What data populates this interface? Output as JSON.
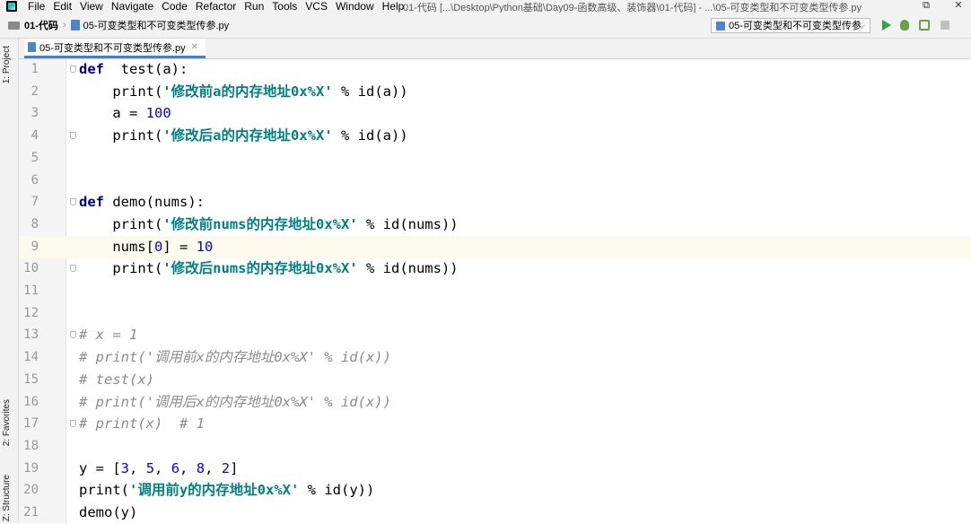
{
  "menubar": {
    "items": [
      "File",
      "Edit",
      "View",
      "Navigate",
      "Code",
      "Refactor",
      "Run",
      "Tools",
      "VCS",
      "Window",
      "Help"
    ],
    "title": "01-代码 [...\\Desktop\\Python基础\\Day09-函数高级、装饰器\\01-代码] - ...\\05-可变类型和不可变类型传参.py",
    "controls": [
      "⧉",
      "✕"
    ]
  },
  "navbar": {
    "project": "01-代码",
    "file": "05-可变类型和不可变类型传参.py",
    "run_config": "05-可变类型和不可变类型传参",
    "dropdown_arrow": "⌵"
  },
  "toolstrip": {
    "project": "1: Project",
    "favorites": "2: Favorites",
    "structure": "Z: Structure"
  },
  "editor_tab": {
    "label": "05-可变类型和不可变类型传参.py",
    "close": "✕"
  },
  "current_line": 9,
  "code_lines": [
    {
      "n": "1",
      "tokens": [
        [
          "kw",
          "def"
        ],
        [
          "",
          "  test(a):"
        ]
      ]
    },
    {
      "n": "2",
      "tokens": [
        [
          "",
          "    print("
        ],
        [
          "str",
          "'修改前a的内存地址0x%X'"
        ],
        [
          "",
          " % id(a))"
        ]
      ]
    },
    {
      "n": "3",
      "tokens": [
        [
          "",
          "    a = "
        ],
        [
          "num",
          "100"
        ]
      ]
    },
    {
      "n": "4",
      "tokens": [
        [
          "",
          "    print("
        ],
        [
          "str",
          "'修改后a的内存地址0x%X'"
        ],
        [
          "",
          " % id(a))"
        ]
      ]
    },
    {
      "n": "5",
      "tokens": []
    },
    {
      "n": "6",
      "tokens": []
    },
    {
      "n": "7",
      "tokens": [
        [
          "kw",
          "def"
        ],
        [
          "",
          " demo(nums):"
        ]
      ]
    },
    {
      "n": "8",
      "tokens": [
        [
          "",
          "    print("
        ],
        [
          "str",
          "'修改前nums的内存地址0x%X'"
        ],
        [
          "",
          " % id(nums))"
        ]
      ]
    },
    {
      "n": "9",
      "tokens": [
        [
          "",
          "    nums["
        ],
        [
          "num",
          "0"
        ],
        [
          "",
          "] = "
        ],
        [
          "num",
          "10"
        ]
      ]
    },
    {
      "n": "10",
      "tokens": [
        [
          "",
          "    print("
        ],
        [
          "str",
          "'修改后nums的内存地址0x%X'"
        ],
        [
          "",
          " % id(nums))"
        ]
      ]
    },
    {
      "n": "11",
      "tokens": []
    },
    {
      "n": "12",
      "tokens": []
    },
    {
      "n": "13",
      "tokens": [
        [
          "cmt",
          "# x = 1"
        ]
      ]
    },
    {
      "n": "14",
      "tokens": [
        [
          "cmt",
          "# print('调用前x的内存地址0x%X' % id(x))"
        ]
      ]
    },
    {
      "n": "15",
      "tokens": [
        [
          "cmt",
          "# test(x)"
        ]
      ]
    },
    {
      "n": "16",
      "tokens": [
        [
          "cmt",
          "# print('调用后x的内存地址0x%X' % id(x))"
        ]
      ]
    },
    {
      "n": "17",
      "tokens": [
        [
          "cmt",
          "# print(x)  # 1"
        ]
      ]
    },
    {
      "n": "18",
      "tokens": []
    },
    {
      "n": "19",
      "tokens": [
        [
          "",
          "y = ["
        ],
        [
          "num",
          "3"
        ],
        [
          "",
          ", "
        ],
        [
          "num",
          "5"
        ],
        [
          "",
          ", "
        ],
        [
          "num",
          "6"
        ],
        [
          "",
          ", "
        ],
        [
          "num",
          "8"
        ],
        [
          "",
          ", "
        ],
        [
          "num",
          "2"
        ],
        [
          "",
          "]"
        ]
      ]
    },
    {
      "n": "20",
      "tokens": [
        [
          "",
          "print("
        ],
        [
          "str",
          "'调用前y的内存地址0x%X'"
        ],
        [
          "",
          " % id(y))"
        ]
      ]
    },
    {
      "n": "21",
      "tokens": [
        [
          "",
          "demo(y)"
        ]
      ]
    }
  ],
  "fold_markers": [
    1,
    4,
    7,
    10,
    13,
    17
  ]
}
